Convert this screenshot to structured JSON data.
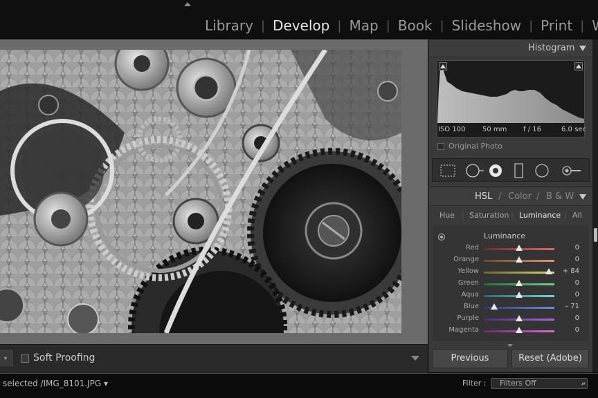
{
  "modules": [
    "Library",
    "Develop",
    "Map",
    "Book",
    "Slideshow",
    "Print",
    "Web"
  ],
  "active_module": "Develop",
  "histogram": {
    "title": "Histogram",
    "iso": "ISO 100",
    "focal": "50 mm",
    "aperture": "f / 16",
    "shutter": "6.0 sec",
    "original_photo_label": "Original Photo"
  },
  "hsl": {
    "header_hsl": "HSL",
    "header_color": "Color",
    "header_bw": "B & W",
    "header_sep": "/",
    "tabs": [
      "Hue",
      "Saturation",
      "Luminance",
      "All"
    ],
    "active_tab": "Luminance",
    "section_title": "Luminance",
    "sliders": [
      {
        "label": "Red",
        "value": 0,
        "display": "0",
        "from": "#6b2a2a",
        "to": "#d86b6b"
      },
      {
        "label": "Orange",
        "value": 0,
        "display": "0",
        "from": "#6b4a2a",
        "to": "#d89a6b"
      },
      {
        "label": "Yellow",
        "value": 84,
        "display": "+ 84",
        "from": "#6b6b2a",
        "to": "#d8d86b"
      },
      {
        "label": "Green",
        "value": 0,
        "display": "0",
        "from": "#2a6b3a",
        "to": "#6bd88a"
      },
      {
        "label": "Aqua",
        "value": 0,
        "display": "0",
        "from": "#2a6b6b",
        "to": "#6bd8d8"
      },
      {
        "label": "Blue",
        "value": -71,
        "display": "– 71",
        "from": "#2a3a7b",
        "to": "#6b8ad8"
      },
      {
        "label": "Purple",
        "value": 0,
        "display": "0",
        "from": "#4a2a7b",
        "to": "#a46bd8"
      },
      {
        "label": "Magenta",
        "value": 0,
        "display": "0",
        "from": "#6b2a6b",
        "to": "#d86bd8"
      }
    ]
  },
  "buttons": {
    "previous": "Previous",
    "reset": "Reset (Adobe)"
  },
  "toolbar": {
    "soft_proofing": "Soft Proofing"
  },
  "status": {
    "text": "selected /IMG_8101.JPG",
    "dropdown_glyph": "▾",
    "filter_label": "Filter :",
    "filter_value": "Filters Off"
  },
  "colors": {
    "panel_bg": "#3a3a3a",
    "canvas_bg": "#6b6b6b",
    "text_active": "#e6e6e6",
    "text_dim": "#9a9a9a"
  }
}
